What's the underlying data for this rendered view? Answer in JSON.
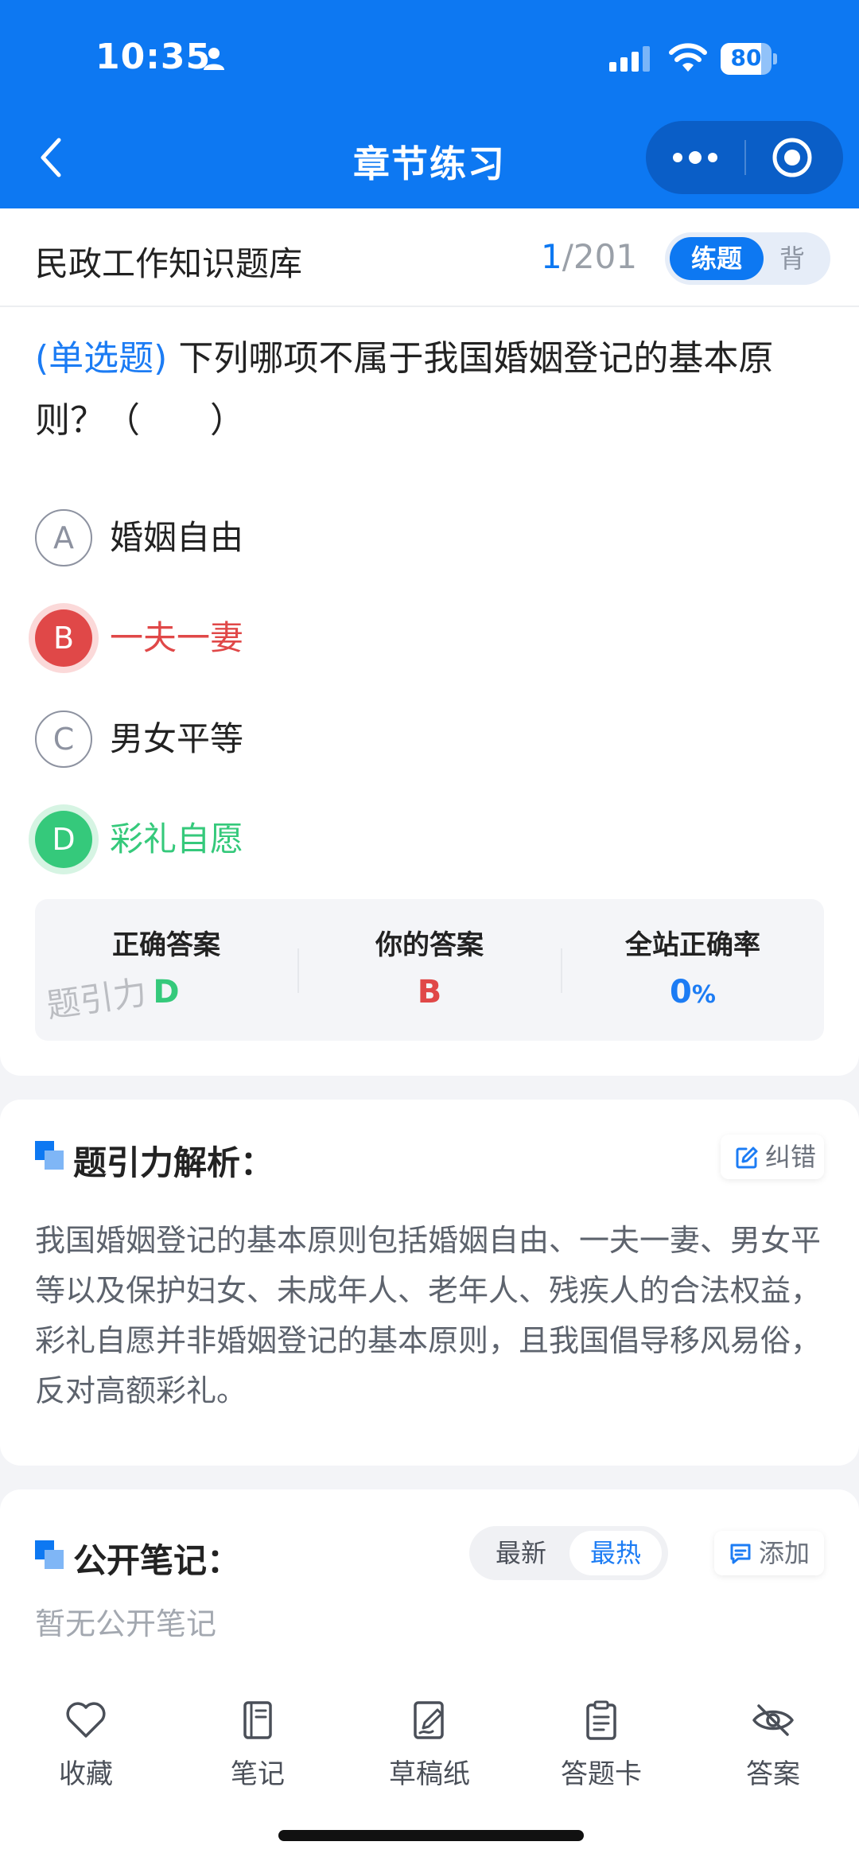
{
  "status_bar": {
    "time": "10:35",
    "battery": "80",
    "battery_level": 0.8
  },
  "nav": {
    "title": "章节练习",
    "icons": [
      "back-arrow-icon",
      "more-dots-icon",
      "target-icon"
    ]
  },
  "question_header": {
    "bank_name": "民政工作知识题库",
    "current": "1",
    "total": "/201",
    "mode_active": "练题",
    "mode_other": "背"
  },
  "question": {
    "type": "(单选题)",
    "text": "下列哪项不属于我国婚姻登记的基本原则？（　　）"
  },
  "options": [
    {
      "letter": "A",
      "text": "婚姻自由",
      "state": "normal"
    },
    {
      "letter": "B",
      "text": "一夫一妻",
      "state": "wrong"
    },
    {
      "letter": "C",
      "text": "男女平等",
      "state": "normal"
    },
    {
      "letter": "D",
      "text": "彩礼自愿",
      "state": "correct"
    }
  ],
  "result": {
    "correct_label": "正确答案",
    "correct_value": "D",
    "yours_label": "你的答案",
    "yours_value": "B",
    "rate_label": "全站正确率",
    "rate_value": "0",
    "rate_unit": "%",
    "watermark": "题引力",
    "colors": {
      "correct": "#35c97b",
      "wrong": "#e04848",
      "accent": "#1c7cf4"
    }
  },
  "analysis": {
    "title": "题引力解析：",
    "report_label": "纠错",
    "text": "我国婚姻登记的基本原则包括婚姻自由、一夫一妻、男女平等以及保护妇女、未成年人、老年人、残疾人的合法权益，彩礼自愿并非婚姻登记的基本原则，且我国倡导移风易俗，反对高额彩礼。"
  },
  "notes": {
    "title": "公开笔记：",
    "sort_latest": "最新",
    "sort_hot": "最热",
    "add_label": "添加",
    "empty_text": "暂无公开笔记"
  },
  "toolbar": {
    "items": [
      {
        "label": "收藏",
        "icon": "heart-icon"
      },
      {
        "label": "笔记",
        "icon": "notebook-icon"
      },
      {
        "label": "草稿纸",
        "icon": "draft-paper-icon"
      },
      {
        "label": "答题卡",
        "icon": "clipboard-icon"
      },
      {
        "label": "答案",
        "icon": "eye-off-icon"
      }
    ]
  },
  "brand_color": "#0d78f2"
}
